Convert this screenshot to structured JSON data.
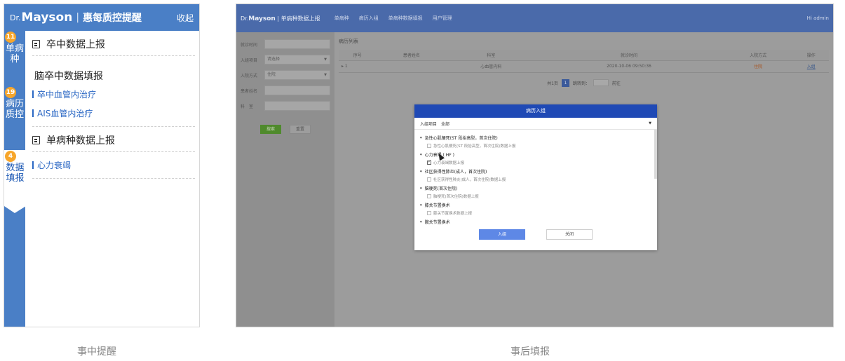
{
  "left_panel": {
    "logo_dr": "Dr.",
    "logo_mayson": "Mayson",
    "separator": "|",
    "title": "惠每质控提醒",
    "collapse_label": "收起",
    "tabs": [
      {
        "badge": "11",
        "label": "单病种"
      },
      {
        "badge": "19",
        "label": "病历质控"
      },
      {
        "badge": "4",
        "label": "数据填报"
      }
    ],
    "sections": [
      {
        "heading": "卒中数据上报"
      },
      {
        "heading": "单病种数据上报"
      }
    ],
    "stroke_sub_heading": "脑卒中数据填报",
    "stroke_links": [
      "卒中血管内治疗",
      "AIS血管内治疗"
    ],
    "single_links": [
      "心力衰竭"
    ]
  },
  "right_screen": {
    "nav": {
      "brand_dr": "Dr.",
      "brand_mayson": "Mayson",
      "brand_title": "| 单病种数据上报",
      "items": [
        "单病种",
        "病历入组",
        "单病种数据填报",
        "用户管理"
      ],
      "user": "Hi admin"
    },
    "filters": [
      {
        "label": "就诊时间",
        "value": ""
      },
      {
        "label": "入组项目",
        "value": "请选择",
        "dropdown": true
      },
      {
        "label": "入院方式",
        "value": "住院",
        "dropdown": true
      },
      {
        "label": "患者姓名",
        "value": ""
      },
      {
        "label": "科　室",
        "value": ""
      }
    ],
    "search_button": "搜索",
    "reset_button": "重置",
    "list_title": "病历列表",
    "table": {
      "headers": [
        "序号",
        "患者姓名",
        "科室",
        "就诊时间",
        "入院方式",
        "操作"
      ],
      "rows": [
        {
          "index": "▸ 1",
          "name": "",
          "dept": "心血管内科",
          "time": "2020-10-06 09:50:36",
          "mode": "住院",
          "action": "入组"
        }
      ]
    },
    "pager": {
      "total": "共1页",
      "current": "1",
      "jump_label": "跳转到：",
      "go": "前往"
    },
    "modal": {
      "title": "病历入组",
      "select_label": "入组项目",
      "select_value": "全部",
      "groups": [
        {
          "name": "急性心肌梗死(ST 段抬高型，首次住院)",
          "item": "急性心肌梗死(ST 段抬高型，首次住院)数据上报",
          "checked": false
        },
        {
          "name": "心力衰竭 ( HF )",
          "item": "心力衰竭数据上报",
          "checked": true
        },
        {
          "name": "社区获得性肺炎(成人，首次住院)",
          "item": "社区获得性肺炎(成人，首次住院)数据上报",
          "checked": false
        },
        {
          "name": "脑梗死(首次住院)",
          "item": "脑梗死(首次住院)数据上报",
          "checked": false
        },
        {
          "name": "膝关节置换术",
          "item": "膝关节置换术数据上报",
          "checked": false
        },
        {
          "name": "髋关节置换术",
          "item": "",
          "checked": false
        }
      ],
      "confirm": "入组",
      "close": "关闭"
    }
  },
  "captions": {
    "left": "事中提醒",
    "right": "事后填报"
  }
}
